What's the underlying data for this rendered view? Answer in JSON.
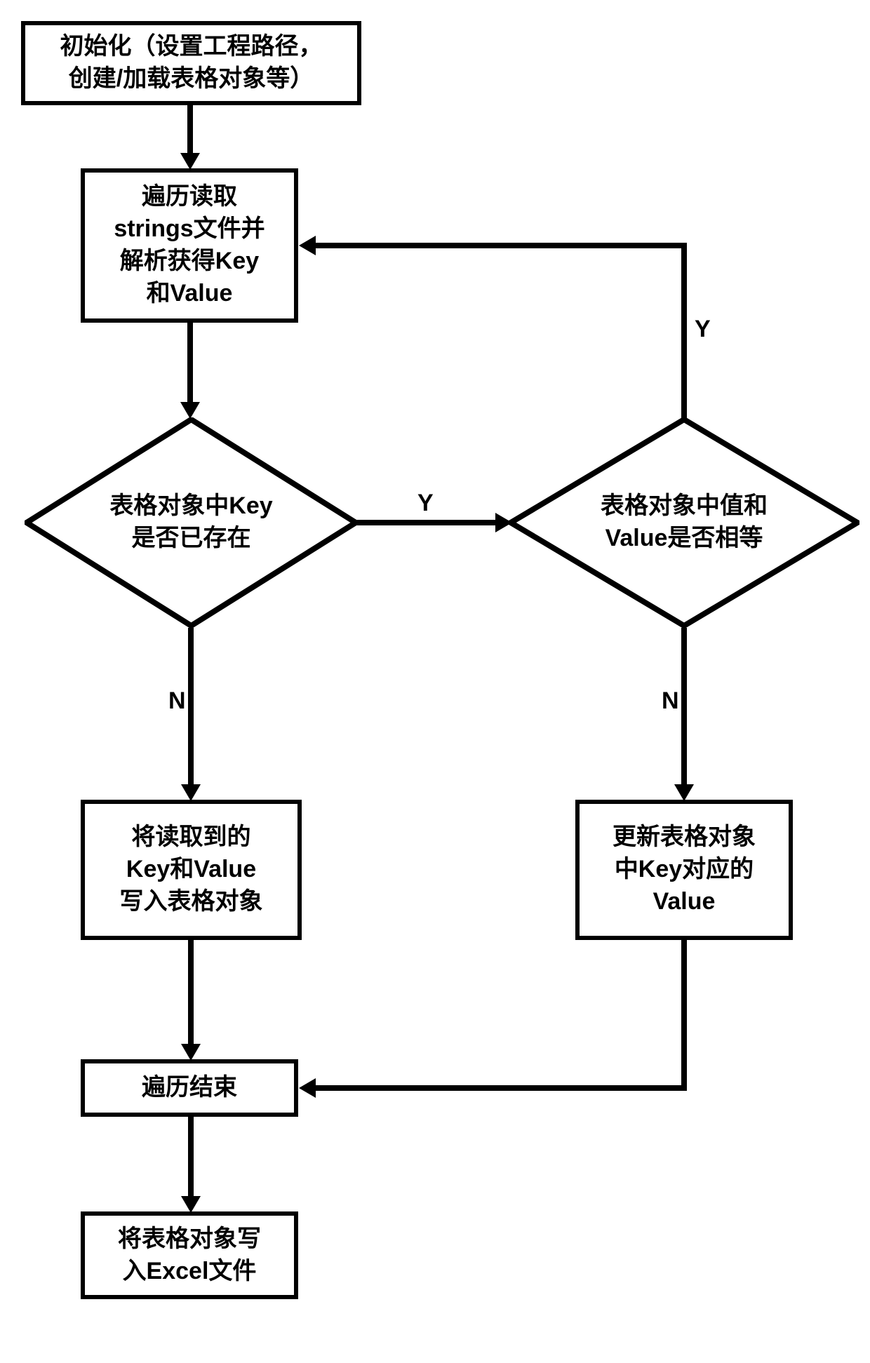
{
  "nodes": {
    "init": "初始化（设置工程路径，\n创建/加载表格对象等）",
    "read": "遍历读取\nstrings文件并\n解析获得Key\n和Value",
    "decision_key": "表格对象中Key\n是否已存在",
    "decision_value": "表格对象中值和\nValue是否相等",
    "write_kv": "将读取到的\nKey和Value\n写入表格对象",
    "update_value": "更新表格对象\n中Key对应的\nValue",
    "end_loop": "遍历结束",
    "write_excel": "将表格对象写\n入Excel文件"
  },
  "labels": {
    "y1": "Y",
    "y2": "Y",
    "n1": "N",
    "n2": "N"
  },
  "chart_data": {
    "type": "flowchart",
    "title": "",
    "nodes": [
      {
        "id": "init",
        "shape": "process",
        "text": "初始化（设置工程路径，创建/加载表格对象等）"
      },
      {
        "id": "read",
        "shape": "process",
        "text": "遍历读取strings文件并解析获得Key和Value"
      },
      {
        "id": "decision_key",
        "shape": "decision",
        "text": "表格对象中Key是否已存在"
      },
      {
        "id": "decision_value",
        "shape": "decision",
        "text": "表格对象中值和Value是否相等"
      },
      {
        "id": "write_kv",
        "shape": "process",
        "text": "将读取到的Key和Value写入表格对象"
      },
      {
        "id": "update_value",
        "shape": "process",
        "text": "更新表格对象中Key对应的Value"
      },
      {
        "id": "end_loop",
        "shape": "process",
        "text": "遍历结束"
      },
      {
        "id": "write_excel",
        "shape": "process",
        "text": "将表格对象写入Excel文件"
      }
    ],
    "edges": [
      {
        "from": "init",
        "to": "read",
        "label": ""
      },
      {
        "from": "read",
        "to": "decision_key",
        "label": ""
      },
      {
        "from": "decision_key",
        "to": "decision_value",
        "label": "Y"
      },
      {
        "from": "decision_key",
        "to": "write_kv",
        "label": "N"
      },
      {
        "from": "decision_value",
        "to": "read",
        "label": "Y"
      },
      {
        "from": "decision_value",
        "to": "update_value",
        "label": "N"
      },
      {
        "from": "write_kv",
        "to": "end_loop",
        "label": ""
      },
      {
        "from": "update_value",
        "to": "end_loop",
        "label": ""
      },
      {
        "from": "end_loop",
        "to": "write_excel",
        "label": ""
      }
    ]
  }
}
